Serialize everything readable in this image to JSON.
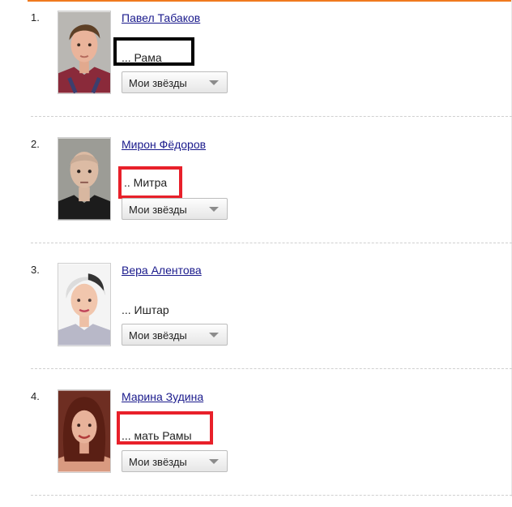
{
  "cast": [
    {
      "number": "1.",
      "actor": "Павел Табаков",
      "role": "... Рама",
      "stars_select": "Мои звёзды",
      "highlight_color": "#000000"
    },
    {
      "number": "2.",
      "actor": "Мирон Фёдоров",
      "role": ".. Митра",
      "stars_select": "Мои звёзды",
      "highlight_color": "#e8202a"
    },
    {
      "number": "3.",
      "actor": "Вера Алентова",
      "role": "... Иштар",
      "stars_select": "Мои звёзды"
    },
    {
      "number": "4.",
      "actor": "Марина Зудина",
      "role": "... мать Рамы",
      "stars_select": "Мои звёзды",
      "highlight_color": "#e8202a"
    }
  ],
  "colors": {
    "accent_rule": "#f07a1e",
    "link": "#1a1a8c"
  },
  "icons": {
    "dropdown": "chevron-down-icon"
  }
}
